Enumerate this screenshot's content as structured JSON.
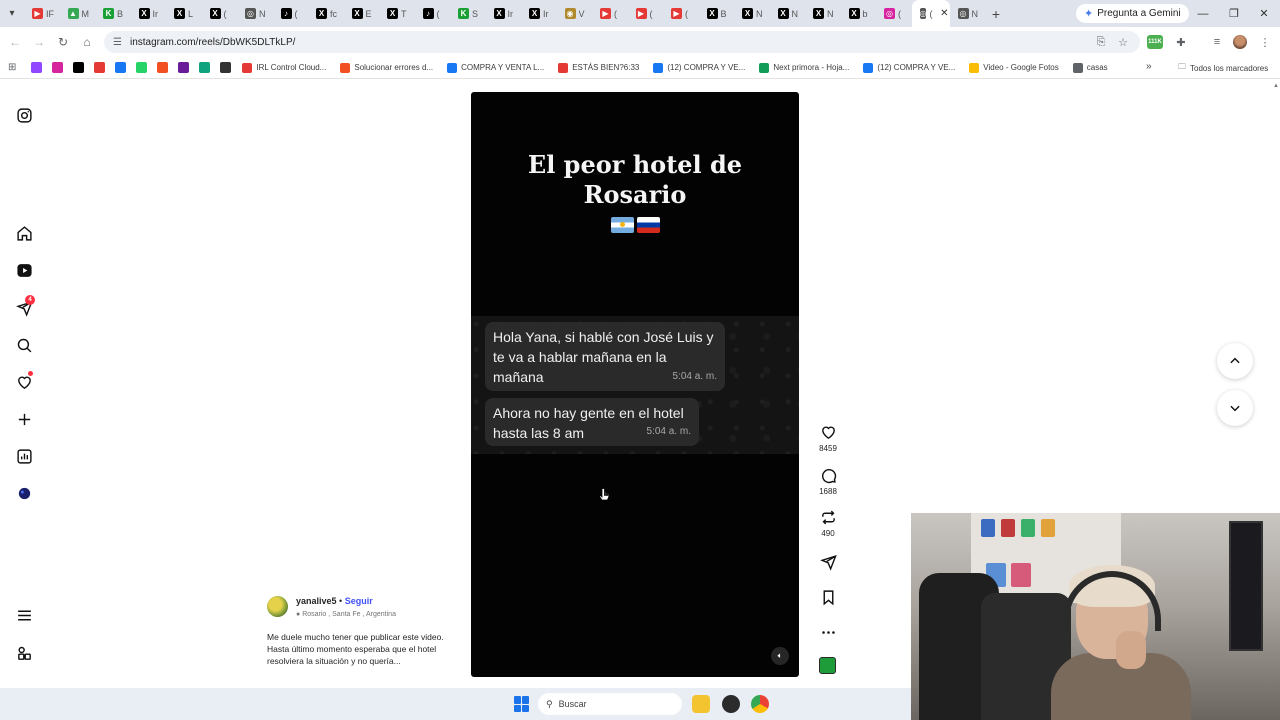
{
  "browser": {
    "tabs": [
      {
        "label": "IF",
        "color": "#e53935",
        "glyph": "▶"
      },
      {
        "label": "M",
        "color": "#34a853",
        "glyph": "▲"
      },
      {
        "label": "B",
        "color": "#1aa034",
        "glyph": "K"
      },
      {
        "label": "Ir",
        "color": "#000000",
        "glyph": "X"
      },
      {
        "label": "L",
        "color": "#000000",
        "glyph": "X"
      },
      {
        "label": "(",
        "color": "#000000",
        "glyph": "X"
      },
      {
        "label": "N",
        "color": "#555555",
        "glyph": "◎"
      },
      {
        "label": "(",
        "color": "#000000",
        "glyph": "♪"
      },
      {
        "label": "fc",
        "color": "#000000",
        "glyph": "X"
      },
      {
        "label": "E",
        "color": "#000000",
        "glyph": "X"
      },
      {
        "label": "T",
        "color": "#000000",
        "glyph": "X"
      },
      {
        "label": "(",
        "color": "#000000",
        "glyph": "♪"
      },
      {
        "label": "S",
        "color": "#1aa034",
        "glyph": "K"
      },
      {
        "label": "Ir",
        "color": "#000000",
        "glyph": "X"
      },
      {
        "label": "Ir",
        "color": "#000000",
        "glyph": "X"
      },
      {
        "label": "V",
        "color": "#b08a2e",
        "glyph": "◉"
      },
      {
        "label": "(",
        "color": "#e53935",
        "glyph": "▶"
      },
      {
        "label": "(",
        "color": "#e53935",
        "glyph": "▶"
      },
      {
        "label": "(",
        "color": "#e53935",
        "glyph": "▶"
      },
      {
        "label": "B",
        "color": "#000000",
        "glyph": "X"
      },
      {
        "label": "N",
        "color": "#000000",
        "glyph": "X"
      },
      {
        "label": "N",
        "color": "#000000",
        "glyph": "X"
      },
      {
        "label": "N",
        "color": "#000000",
        "glyph": "X"
      },
      {
        "label": "b",
        "color": "#000000",
        "glyph": "X"
      },
      {
        "label": "(",
        "color": "#d6249f",
        "glyph": "◎"
      }
    ],
    "active_tab": {
      "label": "(",
      "color": "#555555",
      "glyph": "◎"
    },
    "after_tab": {
      "label": "N",
      "color": "#555555",
      "glyph": "◎"
    },
    "gemini_label": "Pregunta a Gemini",
    "url": "instagram.com/reels/DbWK5DLTkLP/",
    "extension_badge": "111K",
    "bookmarks": [
      {
        "label": "",
        "color": "#9146ff"
      },
      {
        "label": "",
        "color": "#d6249f"
      },
      {
        "label": "",
        "color": "#000000"
      },
      {
        "label": "",
        "color": "#e53935"
      },
      {
        "label": "",
        "color": "#1877f2"
      },
      {
        "label": "",
        "color": "#25d366"
      },
      {
        "label": "",
        "color": "#f25022"
      },
      {
        "label": "",
        "color": "#6a1b9a"
      },
      {
        "label": "",
        "color": "#10a37f"
      },
      {
        "label": "",
        "color": "#333333"
      }
    ],
    "named_bookmarks": [
      {
        "label": "IRL Control Cloud...",
        "color": "#e53935"
      },
      {
        "label": "Solucionar errores d...",
        "color": "#f25022"
      },
      {
        "label": "COMPRA Y VENTA L...",
        "color": "#1877f2"
      },
      {
        "label": "ESTÁS BIEN?6:33",
        "color": "#e53935"
      },
      {
        "label": "(12) COMPRA Y VE...",
        "color": "#1877f2"
      },
      {
        "label": "Next primora - Hoja...",
        "color": "#0f9d58"
      },
      {
        "label": "(12) COMPRA Y VE...",
        "color": "#1877f2"
      },
      {
        "label": "Video - Google Fotos",
        "color": "#fbbc04"
      },
      {
        "label": "casas",
        "color": "#5f6368"
      }
    ],
    "all_bookmarks_label": "Todos los marcadores"
  },
  "sidebar": {
    "notifications_badge": "4"
  },
  "reel": {
    "title_line1": "El peor hotel de",
    "title_line2": "Rosario",
    "messages": [
      {
        "text": "Hola Yana, si hablé con José Luis y te va a hablar mañana en la mañana",
        "time": "5:04 a. m."
      },
      {
        "text": "Ahora no hay gente en el hotel hasta las 8 am",
        "time": "5:04 a. m."
      }
    ]
  },
  "actions": {
    "likes": "8459",
    "comments": "1688",
    "reposts": "490"
  },
  "post": {
    "username": "yanalive5",
    "separator": "•",
    "follow_label": "Seguir",
    "location": "Rosario , Santa Fe , Argentina",
    "caption": "Me duele mucho tener que publicar este video. Hasta último momento esperaba que el hotel resolviera la situación y no quería..."
  },
  "taskbar": {
    "search_placeholder": "Buscar"
  }
}
